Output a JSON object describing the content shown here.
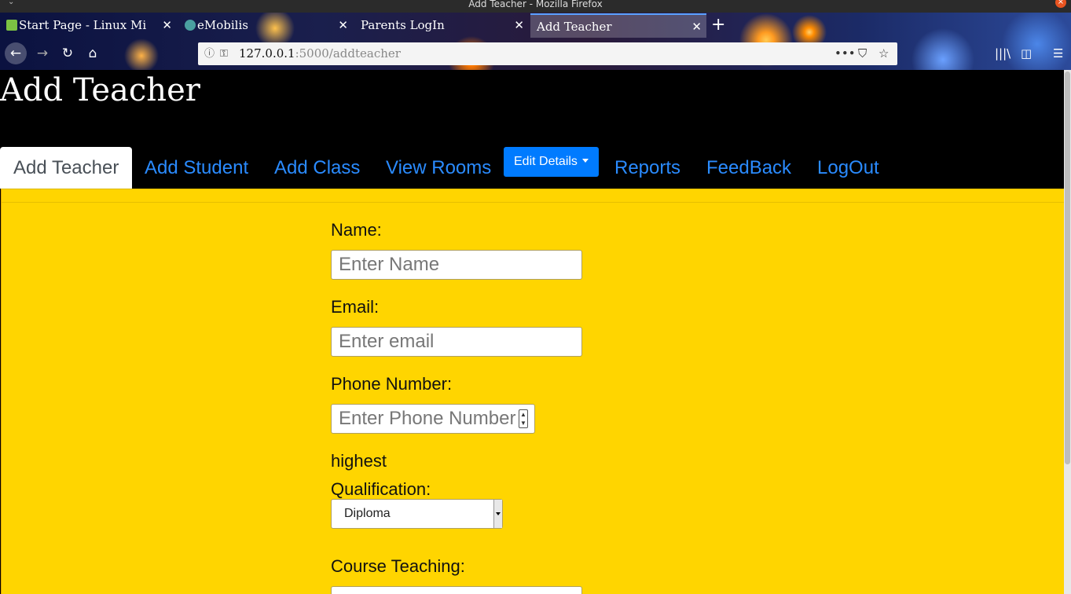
{
  "window": {
    "title": "Add Teacher - Mozilla Firefox"
  },
  "tabs": [
    {
      "label": "Start Page - Linux Mi",
      "favicon_color": "#7cc243",
      "active": false
    },
    {
      "label": "eMobilis",
      "favicon_color": "#4aa0a0",
      "active": false
    },
    {
      "label": "Parents LogIn",
      "favicon_color": "",
      "active": false
    },
    {
      "label": "Add Teacher",
      "favicon_color": "",
      "active": true
    }
  ],
  "toolbar": {
    "url_host": "127.0.0.1",
    "url_rest": ":5000/addteacher",
    "icons": [
      "back-icon",
      "forward-icon",
      "reload-icon",
      "home-icon",
      "info-icon",
      "key-icon",
      "more-icon",
      "pocket-icon",
      "bookmark-star-icon",
      "library-icon",
      "sidebar-icon",
      "menu-icon"
    ]
  },
  "header": {
    "title": "Add Teacher"
  },
  "nav": {
    "items": [
      "Add Teacher",
      "Add Student",
      "Add Class",
      "View Rooms",
      "Reports",
      "FeedBack",
      "LogOut"
    ],
    "edit_details": "Edit Details",
    "active": "Add Teacher"
  },
  "form": {
    "name_label": "Name:",
    "name_placeholder": "Enter Name",
    "email_label": "Email:",
    "email_placeholder": "Enter email",
    "phone_label": "Phone Number:",
    "phone_placeholder": "Enter Phone Number",
    "qualification_label_1": "highest",
    "qualification_label_2": "Qualification:",
    "qualification_value": "Diploma",
    "course_label": "Course Teaching:"
  },
  "colors": {
    "content_bg": "#ffd500",
    "nav_link": "#2a8bff",
    "edit_button": "#007bff"
  }
}
